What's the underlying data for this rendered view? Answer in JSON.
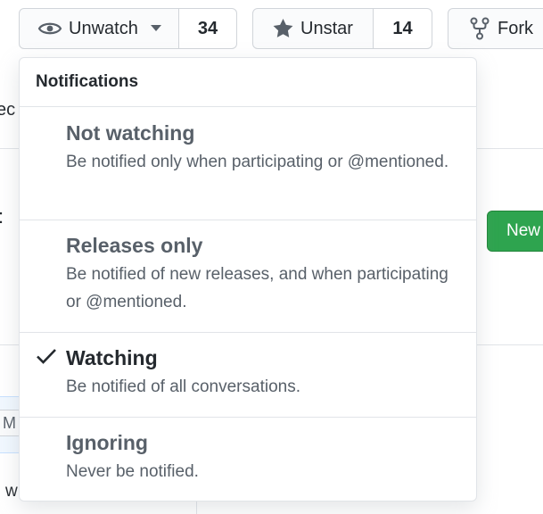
{
  "toolbar": {
    "watch": {
      "label": "Unwatch",
      "count": "34"
    },
    "star": {
      "label": "Unstar",
      "count": "14"
    },
    "fork": {
      "label": "Fork"
    }
  },
  "background": {
    "cut_text_top": "ec",
    "cut_text_mid": "M",
    "cut_text_bottom": "w",
    "new_button_label": "New"
  },
  "notifications": {
    "header": "Notifications",
    "options": [
      {
        "title": "Not watching",
        "description": "Be notified only when participating or @mentioned.",
        "selected": false
      },
      {
        "title": "Releases only",
        "description": "Be notified of new releases, and when participating or @mentioned.",
        "selected": false
      },
      {
        "title": "Watching",
        "description": "Be notified of all conversations.",
        "selected": true
      },
      {
        "title": "Ignoring",
        "description": "Never be notified.",
        "selected": false
      }
    ]
  },
  "colors": {
    "accent_green": "#2ea44f",
    "border": "#d1d5da",
    "text": "#24292e",
    "muted": "#586069"
  },
  "icons": [
    "eye-icon",
    "caret-down-icon",
    "star-icon",
    "fork-icon",
    "check-icon"
  ]
}
